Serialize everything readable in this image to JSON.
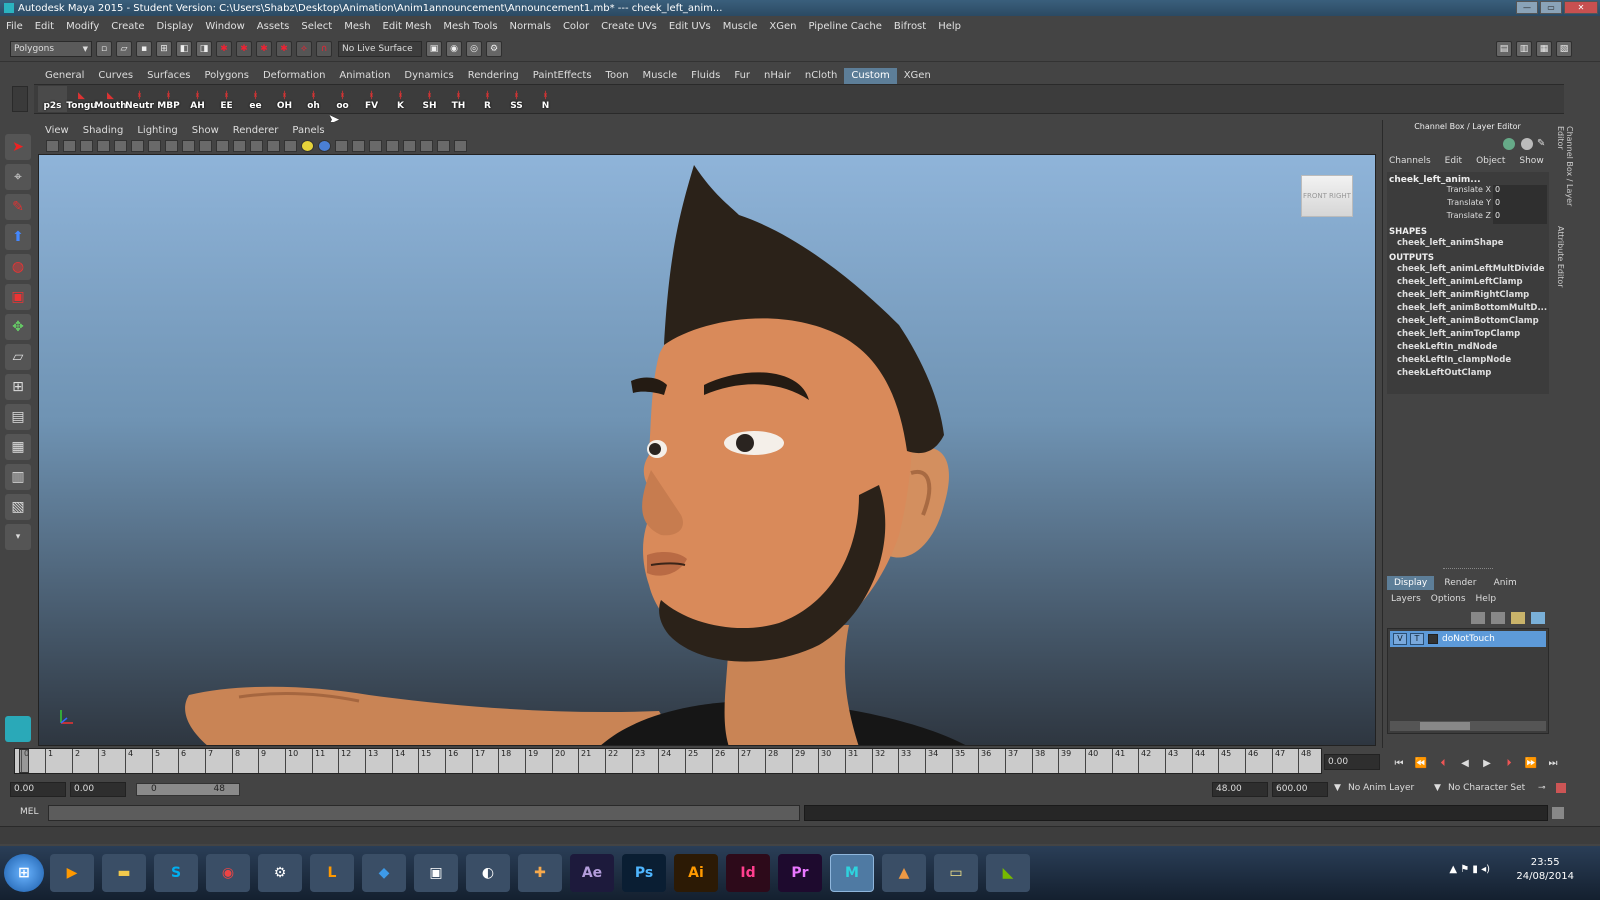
{
  "window": {
    "title": "Autodesk Maya 2015 - Student Version: C:\\Users\\Shabz\\Desktop\\Animation\\Anim1announcement\\Announcement1.mb*   ---   cheek_left_anim..."
  },
  "menubar": [
    "File",
    "Edit",
    "Modify",
    "Create",
    "Display",
    "Window",
    "Assets",
    "Select",
    "Mesh",
    "Edit Mesh",
    "Mesh Tools",
    "Normals",
    "Color",
    "Create UVs",
    "Edit UVs",
    "Muscle",
    "XGen",
    "Pipeline Cache",
    "Bifrost",
    "Help"
  ],
  "statusline": {
    "mode": "Polygons",
    "live_surface": "No Live Surface"
  },
  "shelf": {
    "tabs": [
      "General",
      "Curves",
      "Surfaces",
      "Polygons",
      "Deformation",
      "Animation",
      "Dynamics",
      "Rendering",
      "PaintEffects",
      "Toon",
      "Muscle",
      "Fluids",
      "Fur",
      "nHair",
      "nCloth",
      "Custom",
      "XGen"
    ],
    "active_tab": "Custom",
    "items": [
      "p2s",
      "Tongu",
      "Mouth",
      "Neutr",
      "MBP",
      "AH",
      "EE",
      "ee",
      "OH",
      "oh",
      "oo",
      "FV",
      "K",
      "SH",
      "TH",
      "R",
      "SS",
      "N"
    ]
  },
  "viewport": {
    "menu": [
      "View",
      "Shading",
      "Lighting",
      "Show",
      "Renderer",
      "Panels"
    ],
    "viewcube_front": "FRONT",
    "viewcube_right": "RIGHT"
  },
  "channel_box": {
    "title": "Channel Box / Layer Editor",
    "menu": [
      "Channels",
      "Edit",
      "Object",
      "Show"
    ],
    "node": "cheek_left_anim...",
    "attributes": [
      {
        "name": "Translate X",
        "value": "0"
      },
      {
        "name": "Translate Y",
        "value": "0"
      },
      {
        "name": "Translate Z",
        "value": "0"
      }
    ],
    "shapes_label": "SHAPES",
    "shapes": [
      "cheek_left_animShape"
    ],
    "outputs_label": "OUTPUTS",
    "outputs": [
      "cheek_left_animLeftMultDivide",
      "cheek_left_animLeftClamp",
      "cheek_left_animRightClamp",
      "cheek_left_animBottomMultD...",
      "cheek_left_animBottomClamp",
      "cheek_left_animTopClamp",
      "cheekLeftIn_mdNode",
      "cheekLeftIn_clampNode",
      "cheekLeftOutClamp"
    ],
    "side_tabs": [
      "Channel Box / Layer Editor",
      "Attribute Editor"
    ]
  },
  "layer_editor": {
    "tabs": [
      "Display",
      "Render",
      "Anim"
    ],
    "active_tab": "Display",
    "menu": [
      "Layers",
      "Options",
      "Help"
    ],
    "layer": {
      "v": "V",
      "t": "T",
      "name": "doNotTouch"
    }
  },
  "timeline": {
    "start_frame": "0",
    "ticks": [
      "1",
      "2",
      "3",
      "4",
      "5",
      "6",
      "7",
      "8",
      "9",
      "10",
      "11",
      "12",
      "13",
      "14",
      "15",
      "16",
      "17",
      "18",
      "19",
      "20",
      "21",
      "22",
      "23",
      "24",
      "25",
      "26",
      "27",
      "28",
      "29",
      "30",
      "31",
      "32",
      "33",
      "34",
      "35",
      "36",
      "37",
      "38",
      "39",
      "40",
      "41",
      "42",
      "43",
      "44",
      "45",
      "46",
      "47",
      "48"
    ],
    "current_time": "0.00"
  },
  "range": {
    "start": "0.00",
    "playback_start": "0.00",
    "slider_start": "0",
    "slider_end": "48",
    "playback_end": "48.00",
    "end": "600.00",
    "anim_layer": "No Anim Layer",
    "character_set": "No Character Set"
  },
  "command_line": {
    "label": "MEL"
  },
  "taskbar": {
    "apps": [
      "Ae",
      "Ps",
      "Ai",
      "Id",
      "Pr"
    ],
    "time": "23:55",
    "date": "24/08/2014"
  },
  "colors": {
    "accent": "#5d7e98",
    "layer_highlight": "#5d9ad9",
    "skin": "#d98a5a",
    "hair": "#2b2219"
  }
}
